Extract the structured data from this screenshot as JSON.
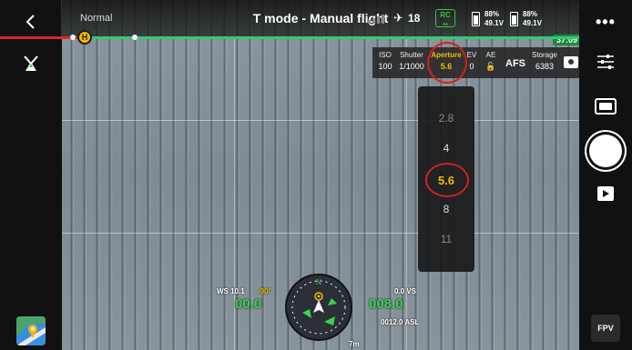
{
  "top_bar": {
    "flight_status": "Normal",
    "mode_title": "T mode - Manual flight",
    "satellite_count": "18",
    "rc_label": "RC",
    "batteries": [
      {
        "percent": "88%",
        "voltage": "49.1V"
      },
      {
        "percent": "88%",
        "voltage": "49.1V"
      }
    ],
    "flight_time": "37:09",
    "progress_red_fraction": 0.14
  },
  "camera_params": {
    "iso": {
      "label": "ISO",
      "value": "100"
    },
    "shutter": {
      "label": "Shutter",
      "value": "1/1000"
    },
    "aperture": {
      "label": "Aperture",
      "value": "5.6"
    },
    "ev": {
      "label": "EV",
      "value": "0"
    },
    "ae": {
      "label": "AE"
    },
    "afs": "AFS",
    "storage": {
      "label": "Storage",
      "value": "6383"
    }
  },
  "aperture_picker": {
    "options": [
      "2.8",
      "4",
      "5.6",
      "8",
      "11"
    ],
    "selected": "5.6"
  },
  "telemetry": {
    "wind": "WS 10.1",
    "gimbal_pitch": "-90°",
    "h_speed": "00.0",
    "v_speed": "0.0 VS",
    "altitude": "008.0",
    "asl": "0012.0 ASL",
    "distance": "7m"
  },
  "right_bar": {
    "fpv_label": "FPV"
  },
  "colors": {
    "accent_yellow": "#f5b800",
    "telemetry_green": "#39d353",
    "highlight_red": "#d42020"
  }
}
